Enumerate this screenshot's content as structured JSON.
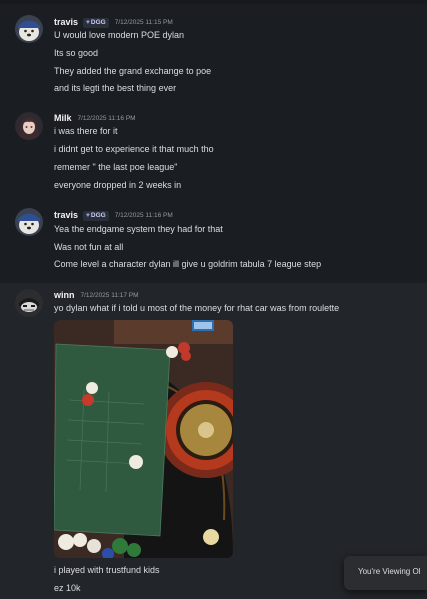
{
  "messages": [
    {
      "user": "travis",
      "tag": "DGG",
      "time": "7/12/2025 11:15 PM",
      "lines": [
        "U would love modern POE dylan",
        "Its so good",
        "They added the grand exchange to poe",
        "and its legti the best thing ever"
      ]
    },
    {
      "user": "Milk",
      "time": "7/12/2025 11:16 PM",
      "lines": [
        "i was there for it",
        "i didnt get to experience it that much tho",
        "rememer \" the last poe league\"",
        "everyone dropped in 2 weeks in"
      ]
    },
    {
      "user": "travis",
      "tag": "DGG",
      "time": "7/12/2025 11:16 PM",
      "lines": [
        "Yea the endgame system they had for that",
        "Was not fun at all",
        "Come level a character dylan ill give u goldrim tabula 7 league step"
      ]
    },
    {
      "user": "winn",
      "time": "7/12/2025 11:17 PM",
      "lines": [
        "yo dylan what if i told u most of the money for rhat car was from roulette"
      ],
      "after_image_lines": [
        "i played with trustfund kids",
        "ez 10k"
      ]
    }
  ],
  "toast": {
    "text": "You're Viewing Ol"
  },
  "attachment": {
    "description_icon": "roulette-table-image"
  },
  "colors": {
    "background": "#1a1d21",
    "highlight": "#22252a",
    "tag_bg": "#2b2f38",
    "tag_text": "#c9cdfb"
  }
}
